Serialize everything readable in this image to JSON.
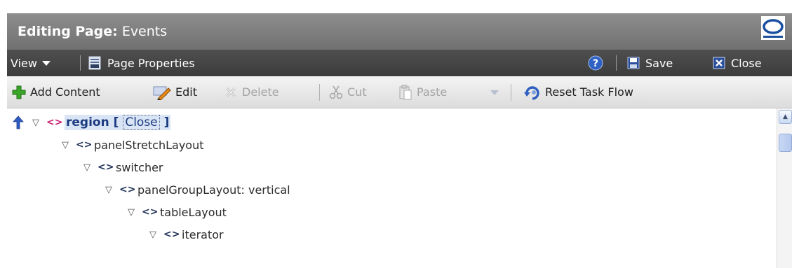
{
  "window": {
    "title_prefix": "Editing Page:",
    "title_name": "Events",
    "logo_icon": "oracle-logo-icon"
  },
  "navbar": {
    "view_label": "View",
    "page_properties_label": "Page Properties",
    "help_label": "?",
    "save_label": "Save",
    "close_label": "Close"
  },
  "toolbar": {
    "add_content_label": "Add Content",
    "edit_label": "Edit",
    "delete_label": "Delete",
    "cut_label": "Cut",
    "paste_label": "Paste",
    "reset_label": "Reset Task Flow"
  },
  "tree": {
    "root": {
      "name": "region",
      "open_bracket": "[",
      "close_label": "Close",
      "close_bracket": "]"
    },
    "nodes": [
      "panelStretchLayout",
      "switcher",
      "panelGroupLayout: vertical",
      "tableLayout",
      "iterator"
    ]
  },
  "colors": {
    "title_bar": "#7f7f7f",
    "nav_bar": "#464646",
    "toolbar": "#e9e9e9",
    "selection": "#d9e5f5",
    "root_tag": "#cc2277"
  }
}
